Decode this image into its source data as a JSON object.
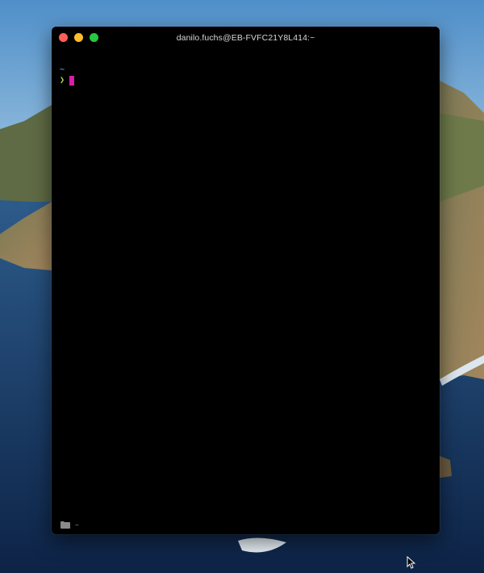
{
  "window": {
    "title": "danilo.fuchs@EB-FVFC21Y8L414:~"
  },
  "terminal": {
    "cwd": "~",
    "prompt_symbol": "❯"
  },
  "statusbar": {
    "path": "~"
  },
  "icons": {
    "close": "close-icon",
    "minimize": "minimize-icon",
    "maximize": "maximize-icon",
    "folder": "folder-icon",
    "mouse_pointer": "mouse-pointer-icon"
  },
  "colors": {
    "terminal_bg": "#000000",
    "cwd": "#6fc7ff",
    "prompt": "#b5e04a",
    "cursor": "#d61fa8",
    "close": "#ff5f57",
    "minimize": "#febc2e",
    "maximize": "#28c840"
  }
}
